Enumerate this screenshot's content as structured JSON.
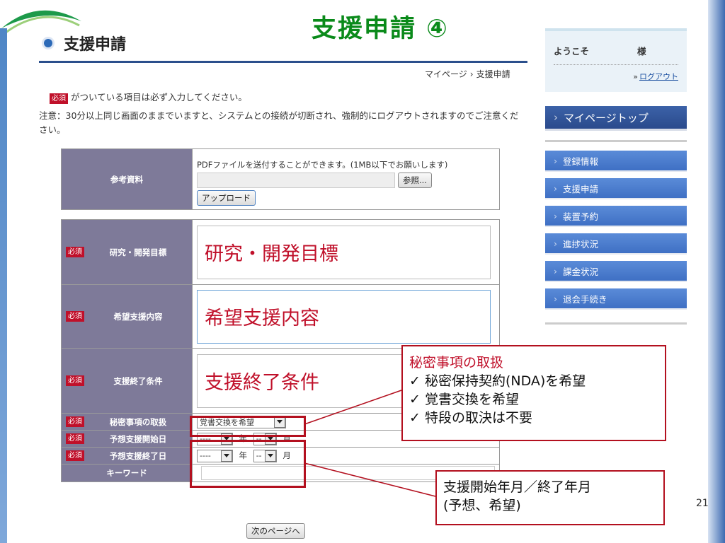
{
  "slide_title": "支援申請 ④",
  "page": {
    "heading": "支援申請",
    "breadcrumb": [
      "マイページ",
      "支援申請"
    ],
    "required_badge": "必須",
    "required_note": "がついている項目は必ず入力してください。",
    "caution": "注意：30分以上同じ画面のままでいますと、システムとの接続が切断され、強制的にログアウトされますのでご注意ください。"
  },
  "reference": {
    "label": "参考資料",
    "note": "PDFファイルを送付することができます。(1MB以下でお願いします)",
    "browse_button": "参照...",
    "upload_button": "アップロード"
  },
  "fields": {
    "goal": {
      "label": "研究・開発目標",
      "value": "研究・開発目標"
    },
    "support": {
      "label": "希望支援内容",
      "value": "希望支援内容"
    },
    "end_condition": {
      "label": "支援終了条件",
      "value": "支援終了条件"
    },
    "secret": {
      "label": "秘密事項の取扱",
      "selected": "覚書交換を希望"
    },
    "start_date": {
      "label": "予想支援開始日",
      "year": "----",
      "year_unit": "年",
      "month": "--",
      "month_unit": "月"
    },
    "end_date": {
      "label": "予想支援終了日",
      "year": "----",
      "year_unit": "年",
      "month": "--",
      "month_unit": "月"
    },
    "keyword": {
      "label": "キーワード",
      "value": ""
    }
  },
  "next_button": "次のページへ",
  "callouts": {
    "secret": {
      "title": "秘密事項の取扱",
      "items": [
        "✓ 秘密保持契約(NDA)を希望",
        "✓ 覚書交換を希望",
        "✓ 特段の取決は不要"
      ]
    },
    "dates": {
      "line1": "支援開始年月／終了年月",
      "line2": "(予想、希望)"
    }
  },
  "sidebar": {
    "welcome": "ようこそ",
    "honorific": "様",
    "logout": "ログアウト",
    "top": "マイページトップ",
    "items": [
      "登録情報",
      "支援申請",
      "装置予約",
      "進捗状況",
      "課金状況",
      "退会手続き"
    ]
  },
  "page_number": "21",
  "colors": {
    "title_green": "#0a8a1a",
    "required_red": "#c0102a",
    "label_purple": "#7e7a99",
    "nav_blue": "#3f70c4"
  }
}
